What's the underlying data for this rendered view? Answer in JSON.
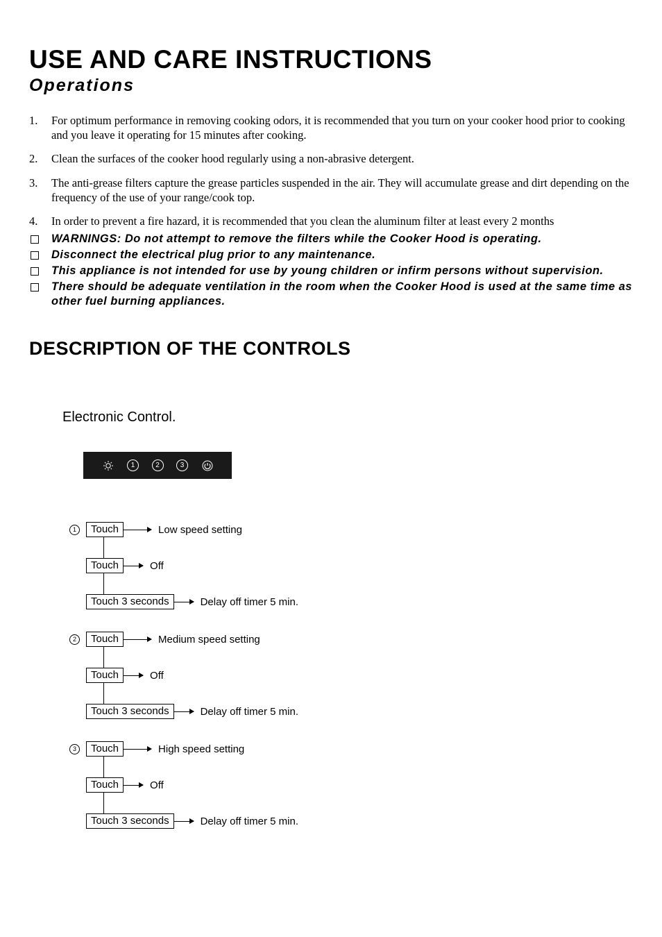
{
  "title": "USE AND CARE INSTRUCTIONS",
  "subtitle": "Operations",
  "ol": [
    {
      "n": "1.",
      "t": "For optimum performance in removing cooking odors, it is recommended that you turn on your cooker hood prior to cooking and you leave it operating for 15 minutes after cooking."
    },
    {
      "n": "2.",
      "t": "Clean the surfaces of the cooker hood regularly using a non-abrasive detergent."
    },
    {
      "n": "3.",
      "t": "The anti-grease filters capture the grease particles suspended in the air. They will accumulate grease and dirt depending on the frequency of the use of your range/cook top."
    },
    {
      "n": "4.",
      "t": "In order to prevent a fire hazard, it is recommended that you clean the aluminum filter at least every 2 months"
    }
  ],
  "warnings": [
    "WARNINGS: Do not attempt to remove the filters while the Cooker Hood is operating.",
    "Disconnect the electrical plug prior to any maintenance.",
    "This appliance is not intended for use by young children or infirm persons without supervision.",
    "There should be adequate ventilation in the room when the Cooker Hood is used at the same time as other fuel burning appliances."
  ],
  "section_h": "DESCRIPTION OF THE CONTROLS",
  "ec_label": "Electronic Control.",
  "panel": {
    "b1": "1",
    "b2": "2",
    "b3": "3"
  },
  "flow": {
    "g1": {
      "num": "1",
      "a1": "Touch",
      "r1": "Low speed setting",
      "a2": "Touch",
      "r2": "Off",
      "a3": "Touch 3 seconds",
      "r3": "Delay off timer 5 min."
    },
    "g2": {
      "num": "2",
      "a1": "Touch",
      "r1": "Medium speed setting",
      "a2": "Touch",
      "r2": "Off",
      "a3": "Touch 3 seconds",
      "r3": "Delay off timer 5 min."
    },
    "g3": {
      "num": "3",
      "a1": "Touch",
      "r1": "High speed setting",
      "a2": "Touch",
      "r2": "Off",
      "a3": "Touch 3 seconds",
      "r3": "Delay off timer 5 min."
    }
  }
}
